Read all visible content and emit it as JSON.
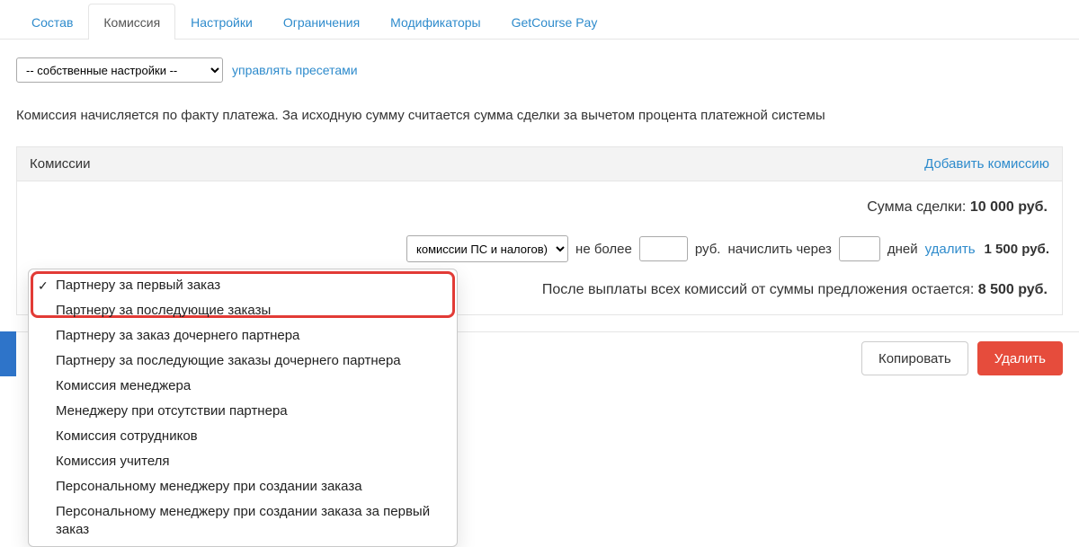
{
  "tabs": [
    {
      "label": "Состав"
    },
    {
      "label": "Комиссия",
      "active": true
    },
    {
      "label": "Настройки"
    },
    {
      "label": "Ограничения"
    },
    {
      "label": "Модификаторы"
    },
    {
      "label": "GetCourse Pay"
    }
  ],
  "preset": {
    "selected": "-- собственные настройки --",
    "manage_link": "управлять пресетами"
  },
  "info_text": "Комиссия начисляется по факту платежа. За исходную сумму считается сумма сделки за вычетом процента платежной системы",
  "panel": {
    "title": "Комиссии",
    "add_link": "Добавить комиссию",
    "sum_label": "Сумма сделки: ",
    "sum_value": "10 000 руб.",
    "line": {
      "base_select": "комиссии ПС и налогов)",
      "limit_prefix": "не более",
      "limit_value": "",
      "rub": "руб.",
      "accrue_prefix": "начислить через",
      "days_value": "",
      "days_label": "дней",
      "delete_link": "удалить",
      "amount": "1 500 руб."
    },
    "remain_label": "После выплаты всех комиссий от суммы предложения остается: ",
    "remain_value": "8 500 руб."
  },
  "footer": {
    "copy": "Копировать",
    "delete": "Удалить"
  },
  "dropdown": {
    "items": [
      "Партнеру за первый заказ",
      "Партнеру за последующие заказы",
      "Партнеру за заказ дочернего партнера",
      "Партнеру за последующие заказы дочернего партнера",
      "Комиссия менеджера",
      "Менеджеру при отсутствии партнера",
      "Комиссия сотрудников",
      "Комиссия учителя",
      "Персональному менеджеру при создании заказа",
      "Персональному менеджеру при создании заказа за первый заказ"
    ]
  }
}
